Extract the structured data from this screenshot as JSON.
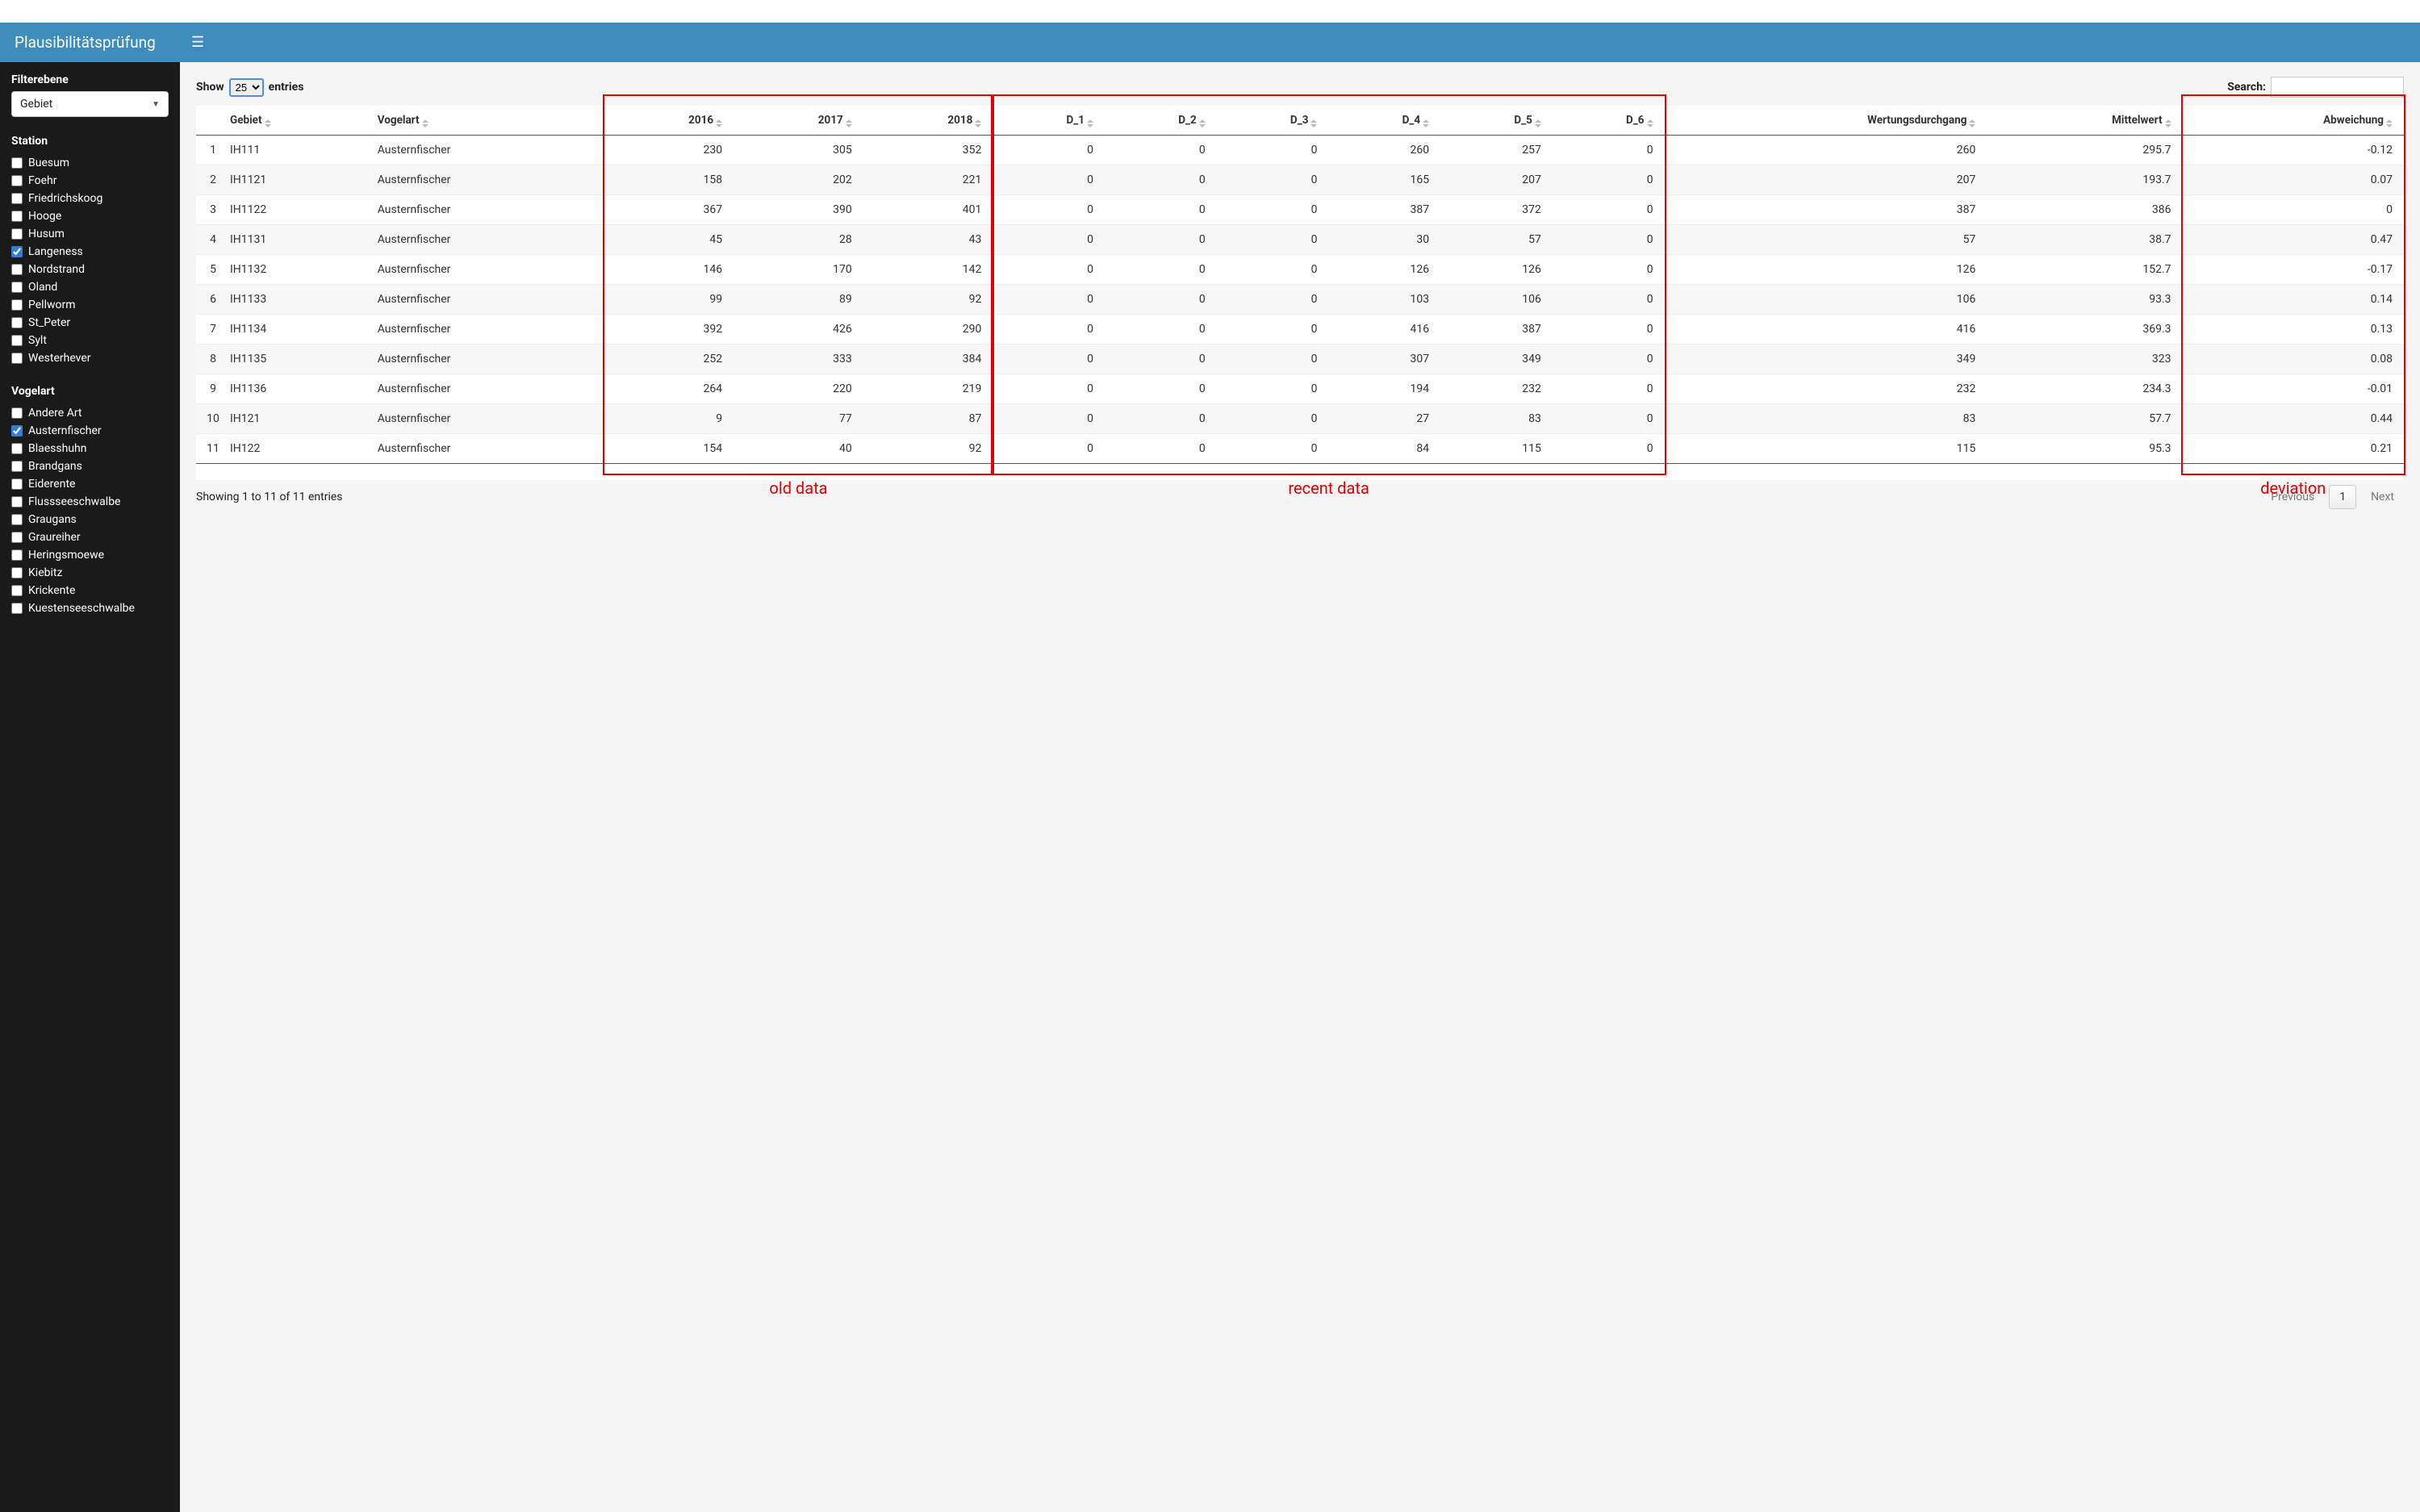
{
  "brand": "Plausibilitätsprüfung",
  "filter": {
    "label": "Filterebene",
    "selected": "Gebiet"
  },
  "station": {
    "title": "Station",
    "items": [
      {
        "label": "Buesum",
        "checked": false
      },
      {
        "label": "Foehr",
        "checked": false
      },
      {
        "label": "Friedrichskoog",
        "checked": false
      },
      {
        "label": "Hooge",
        "checked": false
      },
      {
        "label": "Husum",
        "checked": false
      },
      {
        "label": "Langeness",
        "checked": true
      },
      {
        "label": "Nordstrand",
        "checked": false
      },
      {
        "label": "Oland",
        "checked": false
      },
      {
        "label": "Pellworm",
        "checked": false
      },
      {
        "label": "St_Peter",
        "checked": false
      },
      {
        "label": "Sylt",
        "checked": false
      },
      {
        "label": "Westerhever",
        "checked": false
      }
    ]
  },
  "vogelart": {
    "title": "Vogelart",
    "items": [
      {
        "label": "Andere Art",
        "checked": false
      },
      {
        "label": "Austernfischer",
        "checked": true
      },
      {
        "label": "Blaesshuhn",
        "checked": false
      },
      {
        "label": "Brandgans",
        "checked": false
      },
      {
        "label": "Eiderente",
        "checked": false
      },
      {
        "label": "Flussseeschwalbe",
        "checked": false
      },
      {
        "label": "Graugans",
        "checked": false
      },
      {
        "label": "Graureiher",
        "checked": false
      },
      {
        "label": "Heringsmoewe",
        "checked": false
      },
      {
        "label": "Kiebitz",
        "checked": false
      },
      {
        "label": "Krickente",
        "checked": false
      },
      {
        "label": "Kuestenseeschwalbe",
        "checked": false
      }
    ]
  },
  "table": {
    "show_label_pre": "Show",
    "show_label_post": "entries",
    "show_value": "25",
    "search_label": "Search:",
    "columns": [
      "",
      "Gebiet",
      "Vogelart",
      "2016",
      "2017",
      "2018",
      "D_1",
      "D_2",
      "D_3",
      "D_4",
      "D_5",
      "D_6",
      "Wertungsdurchgang",
      "Mittelwert",
      "Abweichung"
    ],
    "rows": [
      {
        "n": 1,
        "gebiet": "IH111",
        "vogelart": "Austernfischer",
        "y2016": 230,
        "y2017": 305,
        "y2018": 352,
        "d1": 0,
        "d2": 0,
        "d3": 0,
        "d4": 260,
        "d5": 257,
        "d6": 0,
        "wd": 260,
        "mw": "295.7",
        "abw": "-0.12"
      },
      {
        "n": 2,
        "gebiet": "IH1121",
        "vogelart": "Austernfischer",
        "y2016": 158,
        "y2017": 202,
        "y2018": 221,
        "d1": 0,
        "d2": 0,
        "d3": 0,
        "d4": 165,
        "d5": 207,
        "d6": 0,
        "wd": 207,
        "mw": "193.7",
        "abw": "0.07"
      },
      {
        "n": 3,
        "gebiet": "IH1122",
        "vogelart": "Austernfischer",
        "y2016": 367,
        "y2017": 390,
        "y2018": 401,
        "d1": 0,
        "d2": 0,
        "d3": 0,
        "d4": 387,
        "d5": 372,
        "d6": 0,
        "wd": 387,
        "mw": "386",
        "abw": "0"
      },
      {
        "n": 4,
        "gebiet": "IH1131",
        "vogelart": "Austernfischer",
        "y2016": 45,
        "y2017": 28,
        "y2018": 43,
        "d1": 0,
        "d2": 0,
        "d3": 0,
        "d4": 30,
        "d5": 57,
        "d6": 0,
        "wd": 57,
        "mw": "38.7",
        "abw": "0.47"
      },
      {
        "n": 5,
        "gebiet": "IH1132",
        "vogelart": "Austernfischer",
        "y2016": 146,
        "y2017": 170,
        "y2018": 142,
        "d1": 0,
        "d2": 0,
        "d3": 0,
        "d4": 126,
        "d5": 126,
        "d6": 0,
        "wd": 126,
        "mw": "152.7",
        "abw": "-0.17"
      },
      {
        "n": 6,
        "gebiet": "IH1133",
        "vogelart": "Austernfischer",
        "y2016": 99,
        "y2017": 89,
        "y2018": 92,
        "d1": 0,
        "d2": 0,
        "d3": 0,
        "d4": 103,
        "d5": 106,
        "d6": 0,
        "wd": 106,
        "mw": "93.3",
        "abw": "0.14"
      },
      {
        "n": 7,
        "gebiet": "IH1134",
        "vogelart": "Austernfischer",
        "y2016": 392,
        "y2017": 426,
        "y2018": 290,
        "d1": 0,
        "d2": 0,
        "d3": 0,
        "d4": 416,
        "d5": 387,
        "d6": 0,
        "wd": 416,
        "mw": "369.3",
        "abw": "0.13"
      },
      {
        "n": 8,
        "gebiet": "IH1135",
        "vogelart": "Austernfischer",
        "y2016": 252,
        "y2017": 333,
        "y2018": 384,
        "d1": 0,
        "d2": 0,
        "d3": 0,
        "d4": 307,
        "d5": 349,
        "d6": 0,
        "wd": 349,
        "mw": "323",
        "abw": "0.08"
      },
      {
        "n": 9,
        "gebiet": "IH1136",
        "vogelart": "Austernfischer",
        "y2016": 264,
        "y2017": 220,
        "y2018": 219,
        "d1": 0,
        "d2": 0,
        "d3": 0,
        "d4": 194,
        "d5": 232,
        "d6": 0,
        "wd": 232,
        "mw": "234.3",
        "abw": "-0.01"
      },
      {
        "n": 10,
        "gebiet": "IH121",
        "vogelart": "Austernfischer",
        "y2016": 9,
        "y2017": 77,
        "y2018": 87,
        "d1": 0,
        "d2": 0,
        "d3": 0,
        "d4": 27,
        "d5": 83,
        "d6": 0,
        "wd": 83,
        "mw": "57.7",
        "abw": "0.44"
      },
      {
        "n": 11,
        "gebiet": "IH122",
        "vogelart": "Austernfischer",
        "y2016": 154,
        "y2017": 40,
        "y2018": 92,
        "d1": 0,
        "d2": 0,
        "d3": 0,
        "d4": 84,
        "d5": 115,
        "d6": 0,
        "wd": 115,
        "mw": "95.3",
        "abw": "0.21"
      }
    ],
    "showing": "Showing 1 to 11 of 11 entries",
    "pager": {
      "prev": "Previous",
      "current": "1",
      "next": "Next"
    }
  },
  "annotations": {
    "old_data": "old data",
    "recent_data": "recent data",
    "deviation": "deviation"
  }
}
